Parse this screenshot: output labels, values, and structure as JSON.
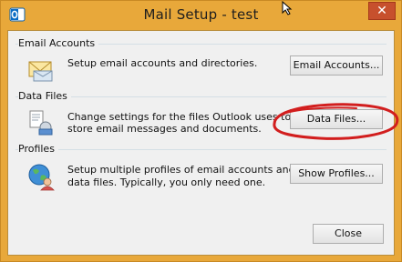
{
  "window": {
    "title": "Mail Setup - test",
    "close_glyph": "✕"
  },
  "sections": {
    "email_accounts": {
      "label": "Email Accounts",
      "description": "Setup email accounts and directories.",
      "button_label": "Email Accounts...",
      "icon": "envelope-icon"
    },
    "data_files": {
      "label": "Data Files",
      "description_line1": "Change settings for the files Outlook uses to",
      "description_line2": "store email messages and documents.",
      "button_label": "Data Files...",
      "icon": "data-files-icon"
    },
    "profiles": {
      "label": "Profiles",
      "description_line1": "Setup multiple profiles of email accounts and",
      "description_line2": "data files. Typically, you only need one.",
      "button_label": "Show Profiles...",
      "icon": "profiles-globe-icon"
    }
  },
  "footer": {
    "close_label": "Close"
  },
  "colors": {
    "frame": "#e8a83a",
    "title_close": "#c7502d",
    "annotation_ellipse": "#d21e1e"
  }
}
